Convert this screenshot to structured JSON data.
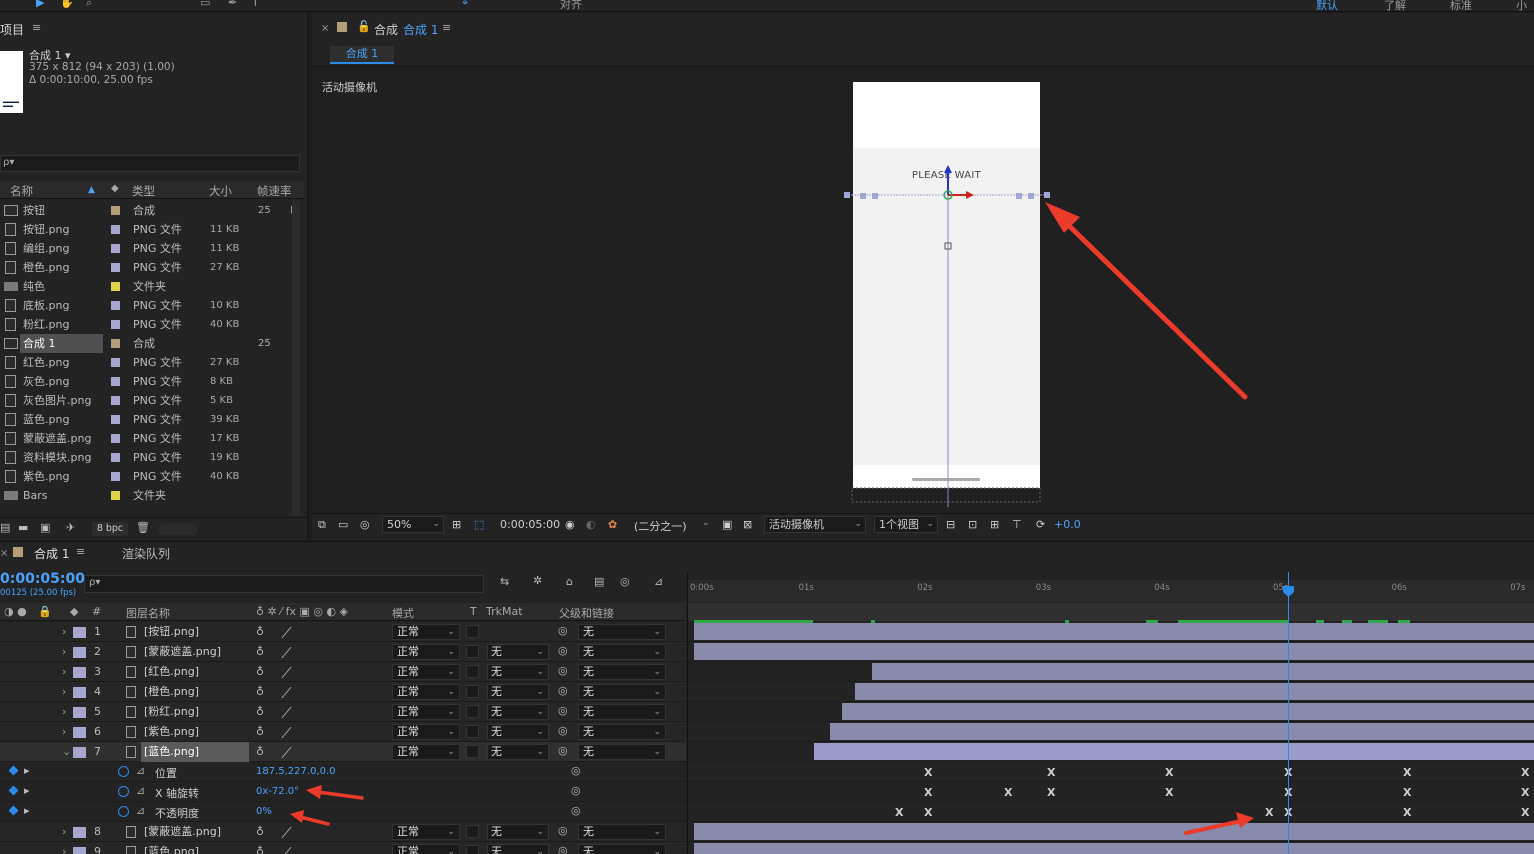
{
  "toolbar": {
    "align_label": "对齐",
    "ws_default": "默认",
    "ws_learn": "了解",
    "ws_standard": "标准",
    "ws_small": "小"
  },
  "project": {
    "tab_title": "项目",
    "comp_name": "合成 1 ▾",
    "comp_size": "375 x 812  (94 x 203) (1.00)",
    "comp_duration": "Δ 0:00:10:00, 25.00 fps",
    "search_placeholder": "ρ▾",
    "columns": {
      "name": "名称",
      "type": "类型",
      "size": "大小",
      "fps": "帧速率"
    },
    "items": [
      {
        "name": "按钮",
        "icon": "comp",
        "color": "#b59f7a",
        "type": "合成",
        "size": "",
        "fps": "25"
      },
      {
        "name": "按钮.png",
        "icon": "file",
        "color": "#a6a6cf",
        "type": "PNG 文件",
        "size": "11 KB",
        "fps": ""
      },
      {
        "name": "编组.png",
        "icon": "file",
        "color": "#a6a6cf",
        "type": "PNG 文件",
        "size": "11 KB",
        "fps": ""
      },
      {
        "name": "橙色.png",
        "icon": "file",
        "color": "#a6a6cf",
        "type": "PNG 文件",
        "size": "27 KB",
        "fps": ""
      },
      {
        "name": "纯色",
        "icon": "folder",
        "color": "#e0d44a",
        "type": "文件夹",
        "size": "",
        "fps": ""
      },
      {
        "name": "底板.png",
        "icon": "file",
        "color": "#a6a6cf",
        "type": "PNG 文件",
        "size": "10 KB",
        "fps": ""
      },
      {
        "name": "粉红.png",
        "icon": "file",
        "color": "#a6a6cf",
        "type": "PNG 文件",
        "size": "40 KB",
        "fps": ""
      },
      {
        "name": "合成 1",
        "icon": "comp",
        "color": "#b59f7a",
        "type": "合成",
        "size": "",
        "fps": "25",
        "selected": true
      },
      {
        "name": "红色.png",
        "icon": "file",
        "color": "#a6a6cf",
        "type": "PNG 文件",
        "size": "27 KB",
        "fps": ""
      },
      {
        "name": "灰色.png",
        "icon": "file",
        "color": "#a6a6cf",
        "type": "PNG 文件",
        "size": "8 KB",
        "fps": ""
      },
      {
        "name": "灰色图片.png",
        "icon": "file",
        "color": "#a6a6cf",
        "type": "PNG 文件",
        "size": "5 KB",
        "fps": ""
      },
      {
        "name": "蓝色.png",
        "icon": "file",
        "color": "#a6a6cf",
        "type": "PNG 文件",
        "size": "39 KB",
        "fps": ""
      },
      {
        "name": "蒙蔽遮盖.png",
        "icon": "file",
        "color": "#a6a6cf",
        "type": "PNG 文件",
        "size": "17 KB",
        "fps": ""
      },
      {
        "name": "资料模块.png",
        "icon": "file",
        "color": "#a6a6cf",
        "type": "PNG 文件",
        "size": "19 KB",
        "fps": ""
      },
      {
        "name": "紫色.png",
        "icon": "file",
        "color": "#a6a6cf",
        "type": "PNG 文件",
        "size": "40 KB",
        "fps": ""
      },
      {
        "name": "Bars",
        "icon": "folder",
        "color": "#e0d44a",
        "type": "文件夹",
        "size": "",
        "fps": ""
      }
    ],
    "bpc": "8 bpc"
  },
  "comp": {
    "tab_title": "合成",
    "tab_name": "合成 1",
    "subtab": "合成 1",
    "camera_label": "活动摄像机",
    "canvas_text": "PLEASE WAIT",
    "zoom": "50%",
    "timecode": "0:00:05:00",
    "resolution": "(二分之一)",
    "view_camera": "活动摄像机",
    "view_count": "1个视图",
    "exposure": "+0.0"
  },
  "timeline": {
    "tab_comp": "合成 1",
    "tab_render": "渲染队列",
    "timecode": "0:00:05:00",
    "timecode_sub": "00125 (25.00 fps)",
    "search_placeholder": "ρ▾",
    "columns": {
      "num": "#",
      "layer_name": "图层名称",
      "mode": "模式",
      "t": "T",
      "trkmat": "TrkMat",
      "parent": "父级和链接"
    },
    "ruler": [
      "0:00s",
      "01s",
      "02s",
      "03s",
      "04s",
      "05s",
      "06s",
      "07s"
    ],
    "layers": [
      {
        "num": "1",
        "name": "[按钮.png]",
        "mode": "正常",
        "trkmat": "",
        "parent": "无",
        "start": 0.0
      },
      {
        "num": "2",
        "name": "[蒙蔽遮盖.png]",
        "mode": "正常",
        "trkmat": "无",
        "parent": "无",
        "start": 0.0
      },
      {
        "num": "3",
        "name": "[红色.png]",
        "mode": "正常",
        "trkmat": "无",
        "parent": "无",
        "start": 0.21
      },
      {
        "num": "4",
        "name": "[橙色.png]",
        "mode": "正常",
        "trkmat": "无",
        "parent": "无",
        "start": 0.19
      },
      {
        "num": "5",
        "name": "[粉红.png]",
        "mode": "正常",
        "trkmat": "无",
        "parent": "无",
        "start": 0.175
      },
      {
        "num": "6",
        "name": "[紫色.png]",
        "mode": "正常",
        "trkmat": "无",
        "parent": "无",
        "start": 0.16
      },
      {
        "num": "7",
        "name": "[蓝色.png]",
        "mode": "正常",
        "trkmat": "无",
        "parent": "无",
        "start": 0.142,
        "selected": true
      }
    ],
    "properties": [
      {
        "name": "位置",
        "value": "187.5,227.0,0.0"
      },
      {
        "name": "X 轴旋转",
        "value": "0x-72.0°"
      },
      {
        "name": "不透明度",
        "value": "0%"
      }
    ],
    "layers_after": [
      {
        "num": "8",
        "name": "[蒙蔽遮盖.png]",
        "mode": "正常",
        "trkmat": "无",
        "parent": "无",
        "start": 0.0
      },
      {
        "num": "9",
        "name": "[蓝色.png]",
        "mode": "正常",
        "trkmat": "无",
        "parent": "无",
        "start": 0.0
      }
    ]
  }
}
